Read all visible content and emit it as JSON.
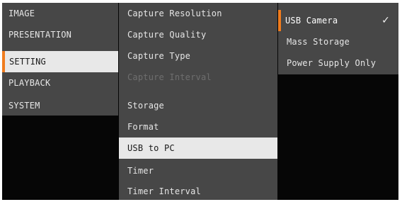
{
  "colors": {
    "menu_bg": "#474747",
    "screen_bg": "#060606",
    "highlight_bg": "#e8e8e8",
    "accent": "#f07c1e",
    "text": "#e6e6e6",
    "disabled_text": "#6e6e6e"
  },
  "main_menu": {
    "items": [
      {
        "label": "IMAGE"
      },
      {
        "label": "PRESENTATION"
      },
      {
        "label": "SETTING",
        "selected": true
      },
      {
        "label": "PLAYBACK"
      },
      {
        "label": "SYSTEM"
      }
    ]
  },
  "setting_menu": {
    "items": [
      {
        "label": "Capture Resolution"
      },
      {
        "label": "Capture Quality"
      },
      {
        "label": "Capture Type"
      },
      {
        "label": "Capture Interval",
        "disabled": true
      },
      {
        "label": "Storage"
      },
      {
        "label": "Format"
      },
      {
        "label": "USB to PC",
        "selected": true
      },
      {
        "label": "Timer"
      },
      {
        "label": "Timer Interval"
      }
    ]
  },
  "usb_menu": {
    "items": [
      {
        "label": "USB Camera",
        "checked": true,
        "check_icon": "checkmark-icon"
      },
      {
        "label": "Mass Storage"
      },
      {
        "label": "Power Supply Only"
      }
    ]
  }
}
